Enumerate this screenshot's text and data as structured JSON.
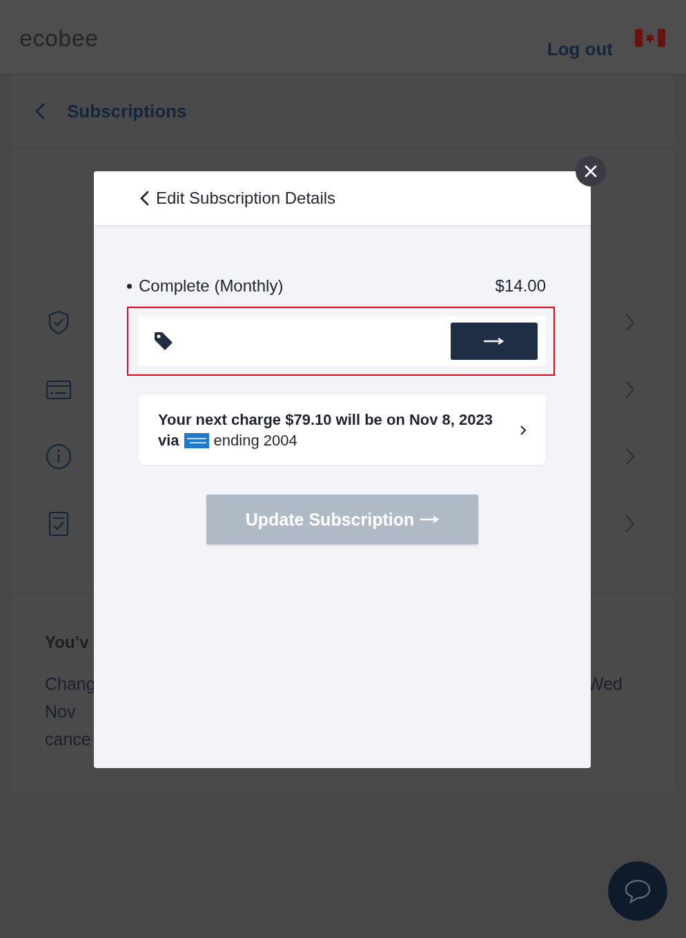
{
  "header": {
    "logo": "ecobee",
    "logout": "Log out"
  },
  "page": {
    "back_title": "Subscriptions",
    "rows": [
      {
        "kind": "shield"
      },
      {
        "kind": "card"
      },
      {
        "kind": "info"
      },
      {
        "kind": "checklist"
      }
    ],
    "notice": {
      "title": "You’v",
      "lines": [
        {
          "left": "Chang",
          "right": "Wed"
        },
        {
          "left": "Nov"
        },
        {
          "left": "cance"
        }
      ]
    }
  },
  "modal": {
    "title": "Edit Subscription Details",
    "plan": {
      "name": "Complete (Monthly)",
      "price": "$14.00"
    },
    "promo": {
      "highlighted": true
    },
    "charge": {
      "text": "Your next charge $79.10 will be on Nov 8, 2023",
      "via": "via",
      "card_suffix": "ending 2004"
    },
    "update_button": {
      "label": "Update Subscription",
      "disabled": true
    }
  }
}
